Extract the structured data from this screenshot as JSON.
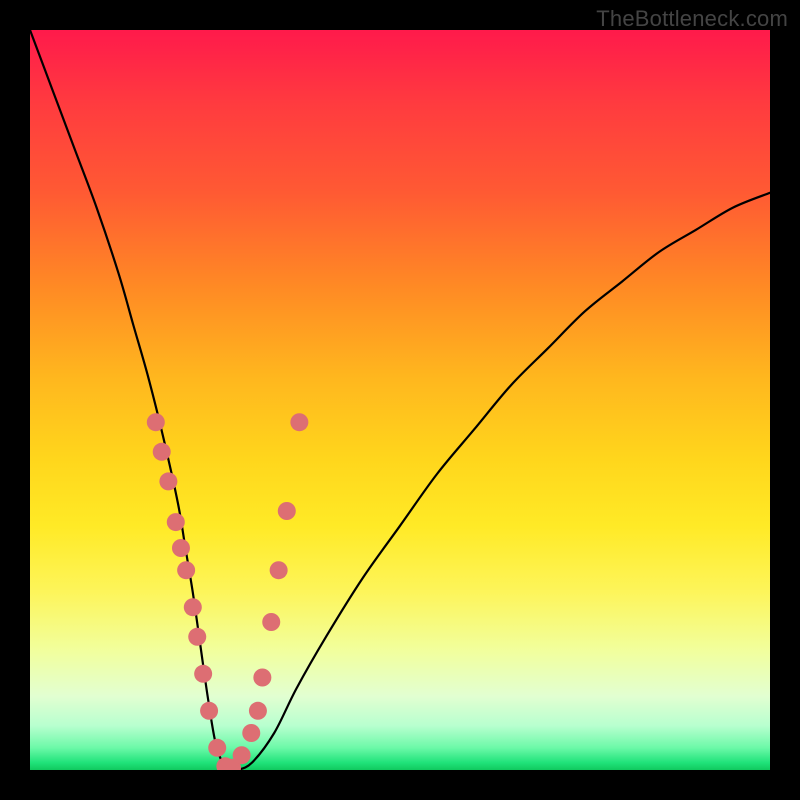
{
  "watermark": {
    "text": "TheBottleneck.com"
  },
  "chart_data": {
    "type": "line",
    "title": "",
    "xlabel": "",
    "ylabel": "",
    "xlim": [
      0,
      100
    ],
    "ylim": [
      0,
      100
    ],
    "grid": false,
    "legend": false,
    "series": [
      {
        "name": "bottleneck-curve",
        "x": [
          0,
          3,
          6,
          9,
          12,
          14,
          16,
          18,
          20,
          21,
          22,
          23,
          24,
          25,
          26,
          27,
          28,
          30,
          33,
          36,
          40,
          45,
          50,
          55,
          60,
          65,
          70,
          75,
          80,
          85,
          90,
          95,
          100
        ],
        "y": [
          100,
          92,
          84,
          76,
          67,
          60,
          53,
          45,
          36,
          30,
          24,
          17,
          10,
          4,
          1,
          0,
          0,
          1,
          5,
          11,
          18,
          26,
          33,
          40,
          46,
          52,
          57,
          62,
          66,
          70,
          73,
          76,
          78
        ]
      }
    ],
    "markers": {
      "name": "highlight-dots",
      "color": "#dd6e73",
      "radius_px": 9,
      "x": [
        17.0,
        17.8,
        18.7,
        19.7,
        20.4,
        21.1,
        22.0,
        22.6,
        23.4,
        24.2,
        25.3,
        26.4,
        27.3,
        28.6,
        29.9,
        30.8,
        31.4,
        32.6,
        33.6,
        34.7,
        36.4
      ],
      "y": [
        47.0,
        43.0,
        39.0,
        33.5,
        30.0,
        27.0,
        22.0,
        18.0,
        13.0,
        8.0,
        3.0,
        0.5,
        0.3,
        2.0,
        5.0,
        8.0,
        12.5,
        20.0,
        27.0,
        35.0,
        47.0
      ]
    },
    "background_gradient": [
      {
        "stop": 0.0,
        "color": "#ff1a4b"
      },
      {
        "stop": 0.5,
        "color": "#ffd61c"
      },
      {
        "stop": 0.9,
        "color": "#e2ffd1"
      },
      {
        "stop": 1.0,
        "color": "#10c95e"
      }
    ]
  }
}
